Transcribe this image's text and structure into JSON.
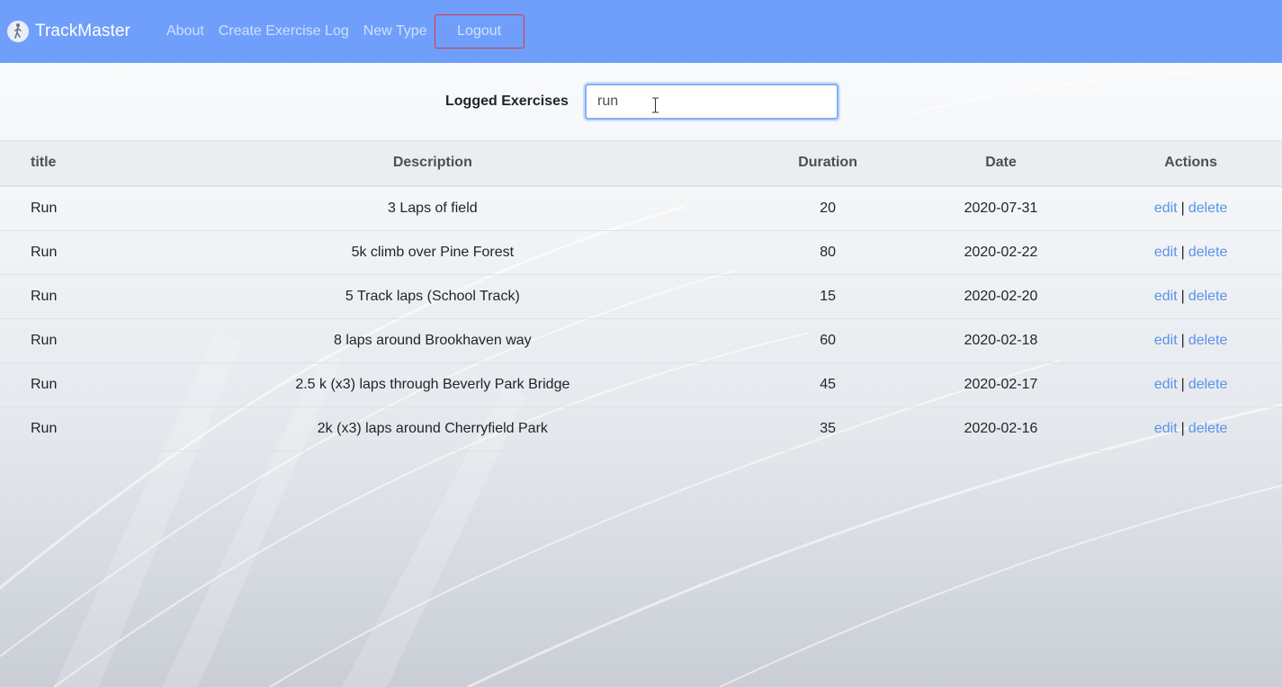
{
  "navbar": {
    "brand": "TrackMaster",
    "links": [
      "About",
      "Create Exercise Log",
      "New Type"
    ],
    "logout_label": "Logout"
  },
  "search": {
    "label": "Logged Exercises",
    "value": "run"
  },
  "table": {
    "headers": [
      "title",
      "Description",
      "Duration",
      "Date",
      "Actions"
    ],
    "rows": [
      {
        "title": "Run",
        "description": "3 Laps of field",
        "duration": "20",
        "date": "2020-07-31"
      },
      {
        "title": "Run",
        "description": "5k climb over Pine Forest",
        "duration": "80",
        "date": "2020-02-22"
      },
      {
        "title": "Run",
        "description": "5 Track laps (School Track)",
        "duration": "15",
        "date": "2020-02-20"
      },
      {
        "title": "Run",
        "description": "8 laps around Brookhaven way",
        "duration": "60",
        "date": "2020-02-18"
      },
      {
        "title": "Run",
        "description": "2.5 k (x3) laps through Beverly Park Bridge",
        "duration": "45",
        "date": "2020-02-17"
      },
      {
        "title": "Run",
        "description": "2k (x3) laps around Cherryfield Park",
        "duration": "35",
        "date": "2020-02-16"
      }
    ],
    "edit_label": "edit",
    "separator": "|",
    "delete_label": "delete"
  },
  "colors": {
    "navbar": "#6f9ffb",
    "link": "#5a93ea",
    "logout_border": "#dc3545"
  },
  "icons": {
    "brand": "runner-icon",
    "cursor": "text-cursor-icon"
  }
}
